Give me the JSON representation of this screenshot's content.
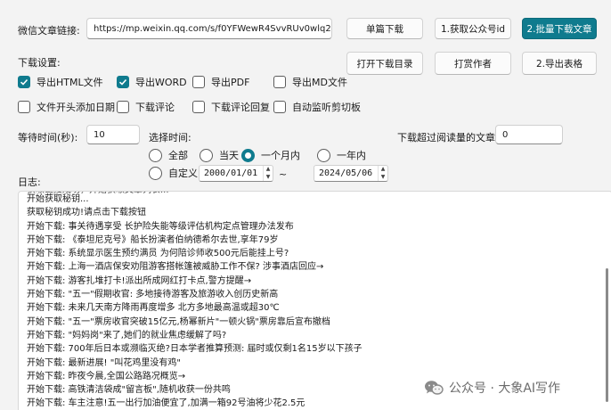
{
  "url_label": "微信文章链接:",
  "url_value": "https://mp.weixin.qq.com/s/f0YFWewR4SvvRUv0wlq2EA",
  "buttons": {
    "single_download": "单篇下载",
    "get_account_id": "1.获取公众号id",
    "batch_download": "2.批量下载文章",
    "open_dir": "打开下载目录",
    "reward_author": "打赏作者",
    "export_table": "2.导出表格"
  },
  "download_settings_label": "下载设置:",
  "checkboxes": [
    {
      "label": "导出HTML文件",
      "checked": true
    },
    {
      "label": "导出WORD",
      "checked": true
    },
    {
      "label": "导出PDF",
      "checked": false
    },
    {
      "label": "导出MD文件",
      "checked": false
    },
    {
      "label": "文件开头添加日期",
      "checked": false
    },
    {
      "label": "下载评论",
      "checked": false
    },
    {
      "label": "下载评论回复",
      "checked": false
    },
    {
      "label": "自动监听剪切板",
      "checked": false
    }
  ],
  "wait_label": "等待时间(秒):",
  "wait_value": "10",
  "time_label": "选择时间:",
  "radios": [
    {
      "label": "全部",
      "selected": false
    },
    {
      "label": "当天",
      "selected": false
    },
    {
      "label": "一个月内",
      "selected": true
    },
    {
      "label": "一年内",
      "selected": false
    },
    {
      "label": "自定义",
      "selected": false
    }
  ],
  "date_from": "2000/01/01",
  "date_to": "2024/05/06",
  "date_sep": "~",
  "read_threshold_label": "下载超过阅读量的文章:",
  "read_threshold_value": "0",
  "log_label": "日志:",
  "log_lines": [
    "开始获取秘钥...",
    "获取秘钥成功!请点击下载按钮",
    "开始下载: 事关待遇享受 长护险失能等级评估机构定点管理办法发布",
    "开始下载: 《泰坦尼克号》船长扮演者伯纳德希尔去世,享年79岁",
    "开始下载: 系统显示医生预约满员 为何陪诊师收500元后能挂上号?",
    "开始下载: 上海一酒店保安劝阻游客搭帐篷被威胁工作不保? 涉事酒店回应→",
    "开始下载: 游客扎堆打卡!派出所成网红打卡点,警方提醒→",
    "开始下载: \"五一\"假期收官: 多地接待游客及旅游收入创历史新高",
    "开始下载: 未来几天南方降雨再度增多 北方多地最高温或超30℃",
    "开始下载: \"五一\"票房收官突破15亿元,杨幂新片\"一顿火锅\"票房靠后宣布撤档",
    "开始下载: \"妈妈岗\"来了,她们的就业焦虑缓解了吗?",
    "开始下载: 700年后日本或濒临灭绝?日本学者推算预测: 届时或仅剩1名15岁以下孩子",
    "开始下载: 最新进展! \"叫花鸡里没有鸡\"",
    "开始下载: 昨夜今晨,全国公路路况概览→",
    "开始下载: 高铁清洁袋成\"留言板\",随机收获一份共鸣",
    "开始下载: 车主注意!五一出行加油便宜了,加满一箱92号油将少花2.5元"
  ],
  "watermark": {
    "text": "公众号 · 大象AI写作",
    "icon": "wechat-logo-icon"
  },
  "colors": {
    "accent": "#0f7b8e",
    "background": "#f3f3f3"
  }
}
